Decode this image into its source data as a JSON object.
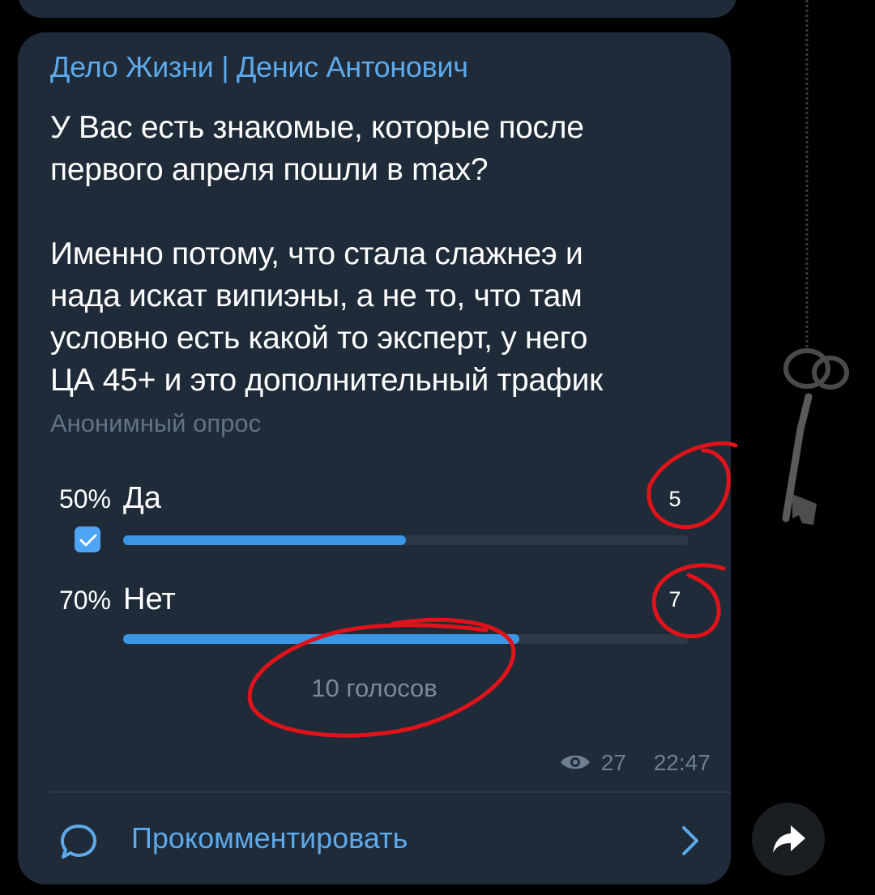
{
  "post": {
    "sender": "Дело Жизни | Денис Антонович",
    "question_lines": [
      "У Вас есть знакомые, которые после",
      "первого апреля пошли в max?",
      "",
      "Именно потому, что стала слажнеэ и",
      "нада искат випиэны, а не то, что там",
      "условно есть какой то эксперт, у него",
      "ЦА 45+ и это дополнительный трафик"
    ]
  },
  "poll": {
    "type_label": "Анонимный опрос",
    "options": [
      {
        "percent_label": "50%",
        "label": "Да",
        "count": "5",
        "fraction": 0.5,
        "chosen": true
      },
      {
        "percent_label": "70%",
        "label": "Нет",
        "count": "7",
        "fraction": 0.7,
        "chosen": false
      }
    ],
    "total": "10 голосов"
  },
  "meta": {
    "views": "27",
    "time": "22:47"
  },
  "actions": {
    "comment_label": "Прокомментировать"
  },
  "colors": {
    "bubble": "#1f2b38",
    "accent": "#5ea9ea",
    "bar": "#3a97e6",
    "annotation": "#e0131b"
  },
  "icons": [
    "eye-icon",
    "check-icon",
    "comment-icon",
    "chevron-right-icon",
    "share-icon",
    "key-icon"
  ]
}
